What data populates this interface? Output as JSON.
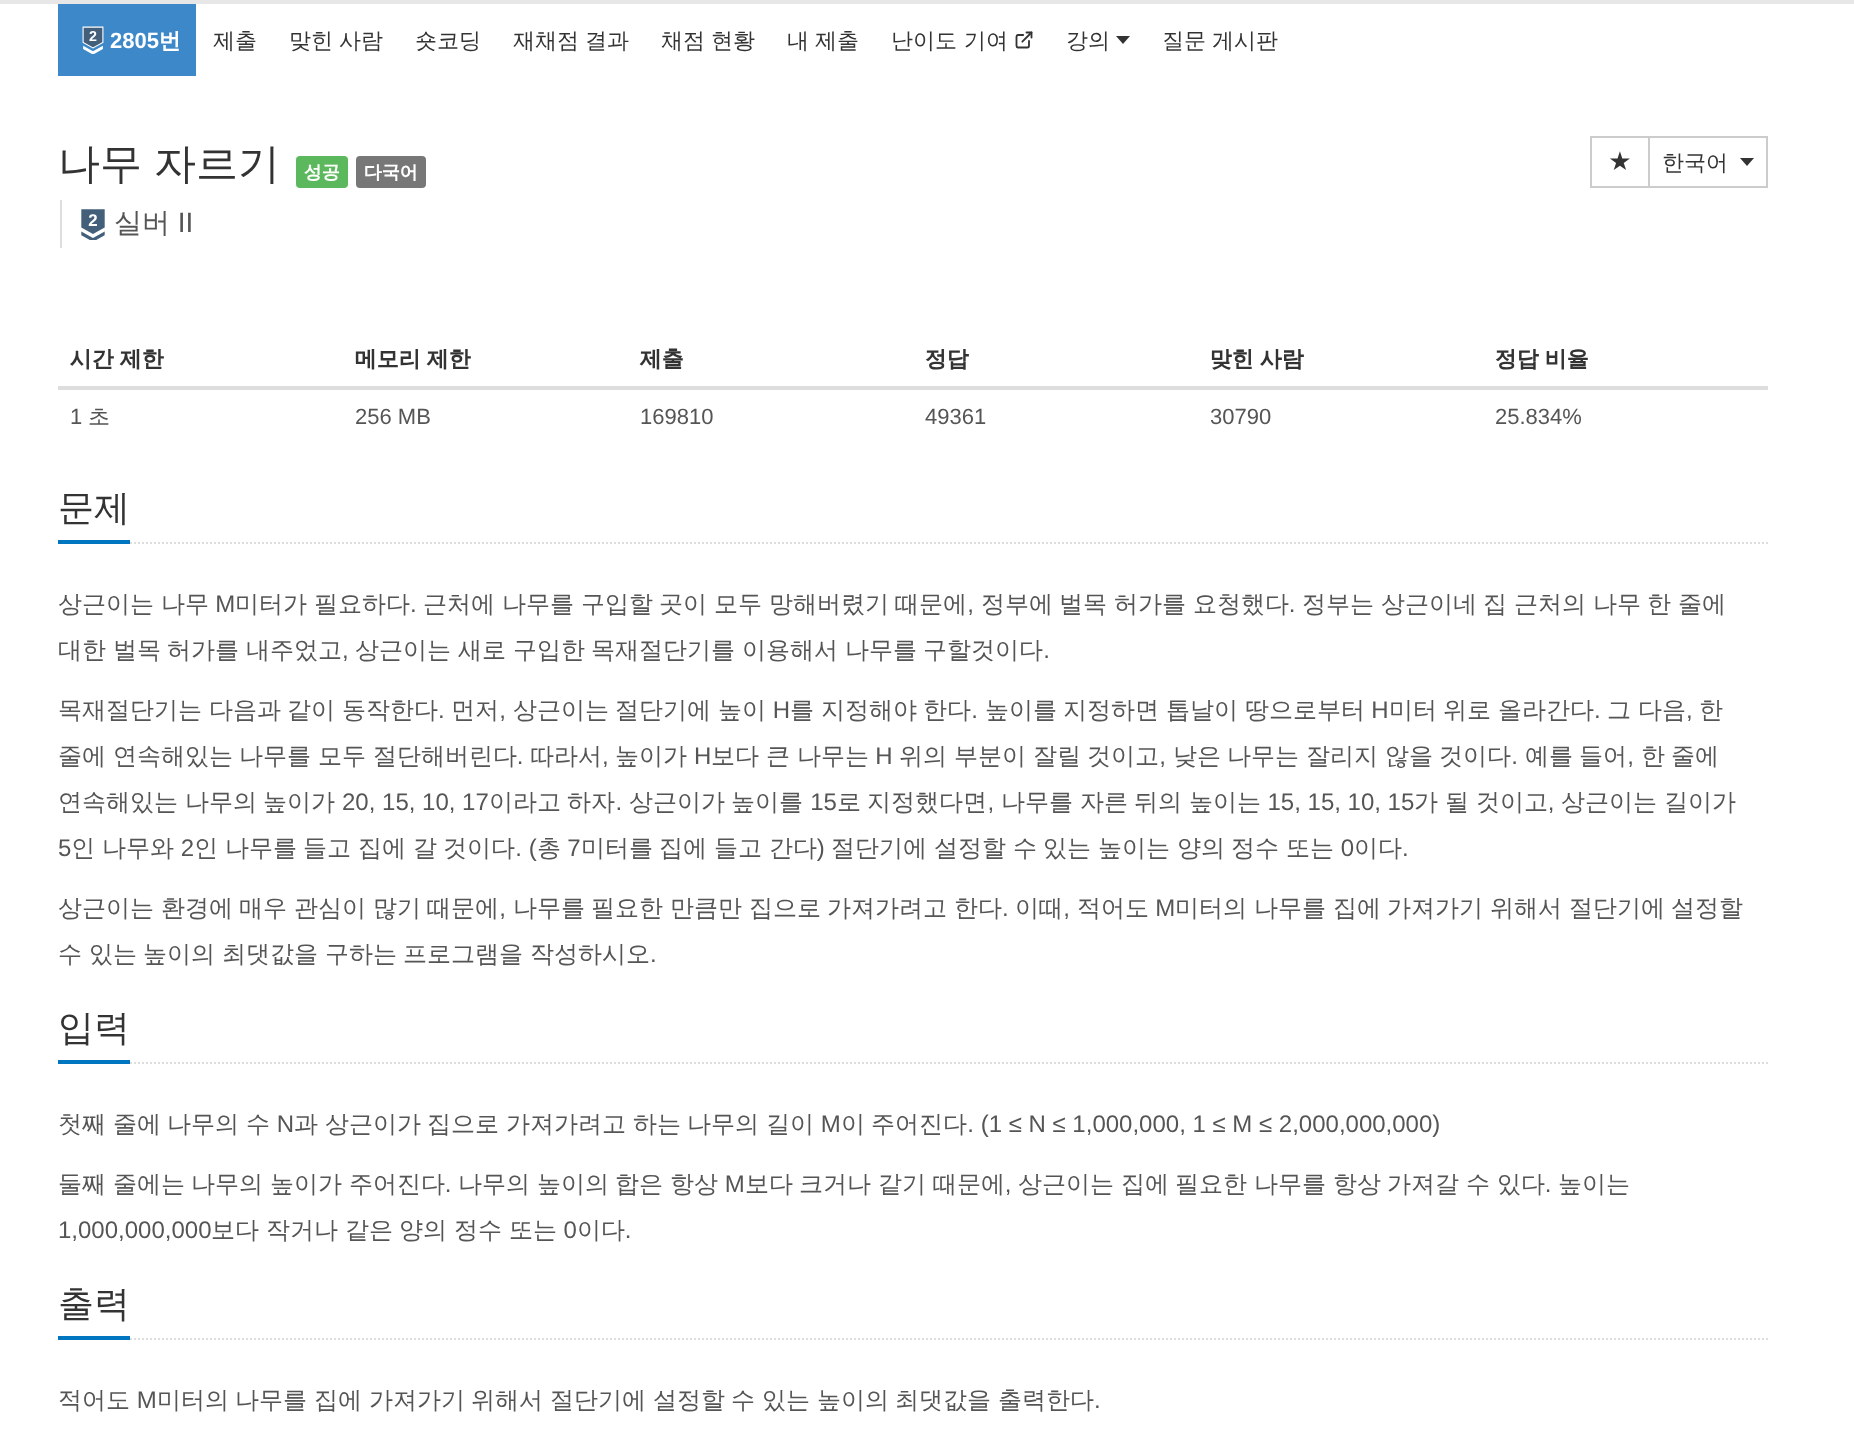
{
  "nav": {
    "tabs": [
      {
        "kind": "problem",
        "tier": "2",
        "label": "2805번",
        "selected": true
      },
      {
        "kind": "link",
        "label": "제출",
        "selected": false
      },
      {
        "kind": "link",
        "label": "맞힌 사람",
        "selected": false
      },
      {
        "kind": "link",
        "label": "숏코딩",
        "selected": false
      },
      {
        "kind": "link",
        "label": "재채점 결과",
        "selected": false
      },
      {
        "kind": "link",
        "label": "채점 현황",
        "selected": false
      },
      {
        "kind": "link",
        "label": "내 제출",
        "selected": false
      },
      {
        "kind": "external",
        "label": "난이도 기여",
        "selected": false
      },
      {
        "kind": "dropdown",
        "label": "강의",
        "selected": false
      },
      {
        "kind": "link",
        "label": "질문 게시판",
        "selected": false
      }
    ]
  },
  "problem": {
    "title": "나무 자르기",
    "badges": [
      {
        "label": "성공",
        "color": "#5cb85c"
      },
      {
        "label": "다국어",
        "color": "#777777"
      }
    ],
    "star": "★",
    "language": "한국어",
    "tier": {
      "number": "2",
      "label": "실버 II"
    }
  },
  "table": {
    "columns": [
      "시간 제한",
      "메모리 제한",
      "제출",
      "정답",
      "맞힌 사람",
      "정답 비율"
    ],
    "rows": [
      [
        "1 초",
        "256 MB",
        "169810",
        "49361",
        "30790",
        "25.834%"
      ]
    ]
  },
  "sections": [
    {
      "title": "문제",
      "paragraphs": [
        "상근이는 나무 M미터가 필요하다. 근처에 나무를 구입할 곳이 모두 망해버렸기 때문에, 정부에 벌목 허가를 요청했다. 정부는 상근이네 집 근처의 나무 한 줄에 대한 벌목 허가를 내주었고, 상근이는 새로 구입한 목재절단기를 이용해서 나무를 구할것이다.",
        "목재절단기는 다음과 같이 동작한다. 먼저, 상근이는 절단기에 높이 H를 지정해야 한다. 높이를 지정하면 톱날이 땅으로부터 H미터 위로 올라간다. 그 다음, 한 줄에 연속해있는 나무를 모두 절단해버린다. 따라서, 높이가 H보다 큰 나무는 H 위의 부분이 잘릴 것이고, 낮은 나무는 잘리지 않을 것이다. 예를 들어, 한 줄에 연속해있는 나무의 높이가 20, 15, 10, 17이라고 하자. 상근이가 높이를 15로 지정했다면, 나무를 자른 뒤의 높이는 15, 15, 10, 15가 될 것이고, 상근이는 길이가 5인 나무와 2인 나무를 들고 집에 갈 것이다. (총 7미터를 집에 들고 간다) 절단기에 설정할 수 있는 높이는 양의 정수 또는 0이다.",
        "상근이는 환경에 매우 관심이 많기 때문에, 나무를 필요한 만큼만 집으로 가져가려고 한다. 이때, 적어도 M미터의 나무를 집에 가져가기 위해서 절단기에 설정할 수 있는 높이의 최댓값을 구하는 프로그램을 작성하시오."
      ]
    },
    {
      "title": "입력",
      "paragraphs": [
        "첫째 줄에 나무의 수 N과 상근이가 집으로 가져가려고 하는 나무의 길이 M이 주어진다. (1 ≤ N ≤ 1,000,000, 1 ≤ M ≤ 2,000,000,000)",
        "둘째 줄에는 나무의 높이가 주어진다. 나무의 높이의 합은 항상 M보다 크거나 같기 때문에, 상근이는 집에 필요한 나무를 항상 가져갈 수 있다. 높이는 1,000,000,000보다 작거나 같은 양의 정수 또는 0이다."
      ]
    },
    {
      "title": "출력",
      "paragraphs": [
        "적어도 M미터의 나무를 집에 가져가기 위해서 절단기에 설정할 수 있는 높이의 최댓값을 출력한다."
      ]
    }
  ]
}
